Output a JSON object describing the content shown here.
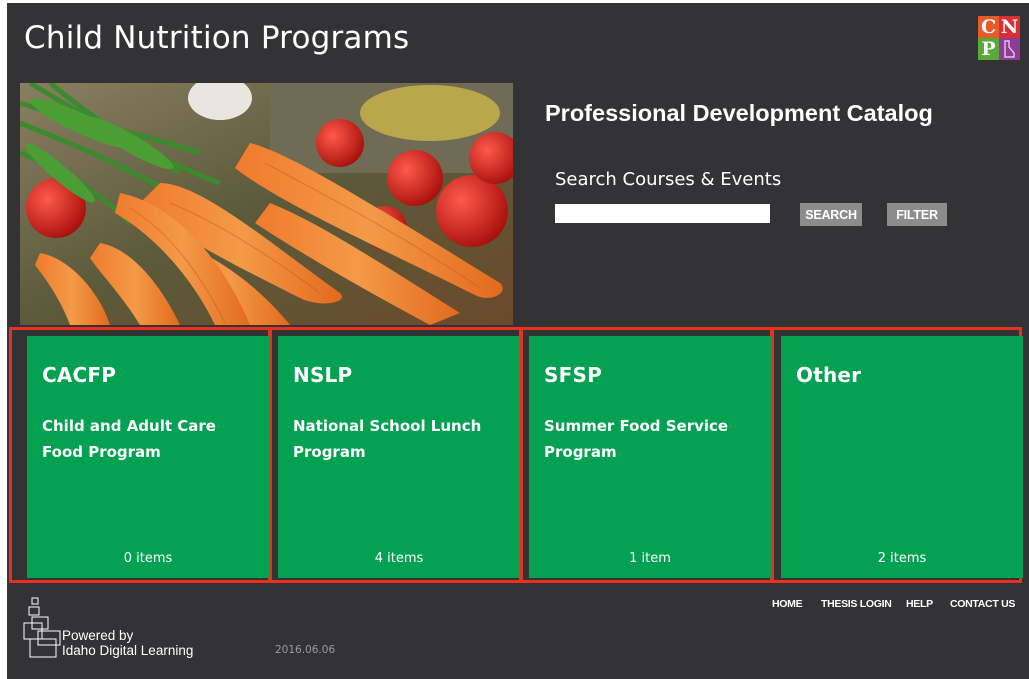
{
  "header": {
    "site_title": "Child Nutrition Programs",
    "logo_letters": [
      "C",
      "N",
      "P"
    ]
  },
  "hero": {
    "image": "carrots-and-tomatoes-photo",
    "catalog_title": "Professional Development Catalog",
    "search_label": "Search Courses & Events",
    "search_value": "",
    "search_button": "SEARCH",
    "filter_button": "FILTER"
  },
  "programs": [
    {
      "abbr": "CACFP",
      "name": "Child and Adult Care Food Program",
      "count": "0 items"
    },
    {
      "abbr": "NSLP",
      "name": "National School Lunch Program",
      "count": "4 items"
    },
    {
      "abbr": "SFSP",
      "name": "Summer Food Service Program",
      "count": "1 item"
    },
    {
      "abbr": "Other",
      "name": "",
      "count": "2 items"
    }
  ],
  "footer": {
    "powered_line1": "Powered by",
    "powered_line2": "Idaho Digital Learning",
    "version": "2016.06.06",
    "nav": [
      "HOME",
      "THESIS LOGIN",
      "HELP",
      "CONTACT US"
    ]
  },
  "colors": {
    "background": "#333235",
    "tile_green": "#03a151",
    "highlight_red": "#e8311f",
    "button_gray": "#8d8c8c"
  },
  "icons": [
    "cnp-logo-icon",
    "idaho-digital-learning-logo-icon"
  ]
}
